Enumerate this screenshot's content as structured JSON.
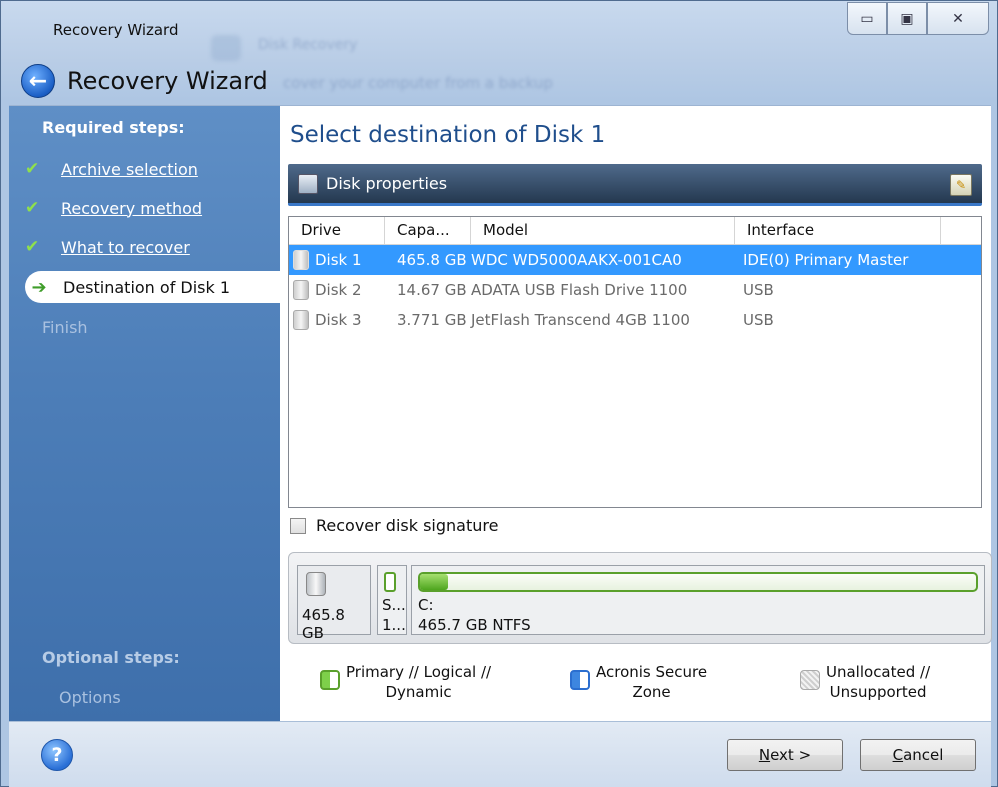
{
  "window": {
    "title": "Recovery Wizard",
    "nav_title": "Recovery Wizard",
    "ghost_title": "Disk Recovery",
    "ghost_subtitle": "cover your computer from a backup",
    "minimize_glyph": "▭",
    "maximize_glyph": "▣",
    "close_glyph": "✕"
  },
  "sidebar": {
    "required_heading": "Required steps:",
    "steps": [
      {
        "label": "Archive selection"
      },
      {
        "label": "Recovery method"
      },
      {
        "label": "What to recover"
      }
    ],
    "current_step": "Destination of Disk 1",
    "finish": "Finish",
    "optional_heading": "Optional steps:",
    "options": "Options"
  },
  "main": {
    "title": "Select destination of Disk 1",
    "panel_title": "Disk properties",
    "columns": [
      "Drive",
      "Capa...",
      "Model",
      "Interface"
    ],
    "rows": [
      {
        "drive": "Disk 1",
        "capacity": "465.8 GB",
        "model": "WDC WD5000AAKX-001CA0",
        "interface": "IDE(0) Primary Master",
        "selected": true
      },
      {
        "drive": "Disk 2",
        "capacity": "14.67 GB",
        "model": "ADATA USB Flash Drive 1100",
        "interface": "USB",
        "selected": false
      },
      {
        "drive": "Disk 3",
        "capacity": "3.771 GB",
        "model": "JetFlash Transcend 4GB 1100",
        "interface": "USB",
        "selected": false
      }
    ],
    "recover_signature_label": "Recover disk signature",
    "diskmap": {
      "disk_size": "465.8 GB",
      "part1_line1": "S...",
      "part1_line2": "1...",
      "part2_line1": "C:",
      "part2_line2": "465.7 GB  NTFS",
      "part2_used_fraction": 0.05
    },
    "legend": {
      "primary": "Primary // Logical //\nDynamic",
      "asz": "Acronis Secure\nZone",
      "unalloc": "Unallocated //\nUnsupported"
    }
  },
  "footer": {
    "next_label": "Next >",
    "next_mnemonic": "N",
    "next_rest": "ext >",
    "cancel_mnemonic": "C",
    "cancel_rest": "ancel"
  },
  "colors": {
    "selection": "#3399ff",
    "title_blue": "#1f4e8c",
    "check_green": "#8fe04c",
    "partition_green": "#5aa02c"
  }
}
